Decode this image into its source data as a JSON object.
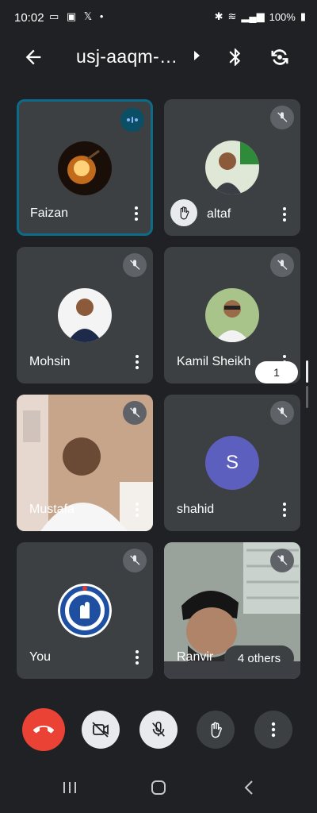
{
  "status_bar": {
    "time": "10:02",
    "battery": "100%"
  },
  "header": {
    "meeting_code": "usj-aaqm-…"
  },
  "participants": [
    {
      "name": "Faizan",
      "state": "speaking"
    },
    {
      "name": "altaf",
      "state": "muted",
      "hand_raised": true
    },
    {
      "name": "Mohsin",
      "state": "muted"
    },
    {
      "name": "Kamil Sheikh",
      "state": "muted"
    },
    {
      "name": "Mustafa",
      "state": "muted",
      "video": true
    },
    {
      "name": "shahid",
      "state": "muted",
      "avatar_letter": "S"
    },
    {
      "name": "You",
      "state": "muted"
    },
    {
      "name": "Ranvir",
      "state": "muted",
      "video": true
    }
  ],
  "others_label": "4 others",
  "raised_hand_count": "1",
  "colors": {
    "background": "#202124",
    "tile": "#3c4043",
    "active_border": "#0b6b88",
    "end_call": "#ea4335",
    "avatar_s": "#5c5fbd"
  },
  "controls": {
    "end_call": "end-call",
    "camera": "camera-off",
    "microphone": "mic-off",
    "raise_hand": "raise-hand",
    "more": "more-options"
  }
}
